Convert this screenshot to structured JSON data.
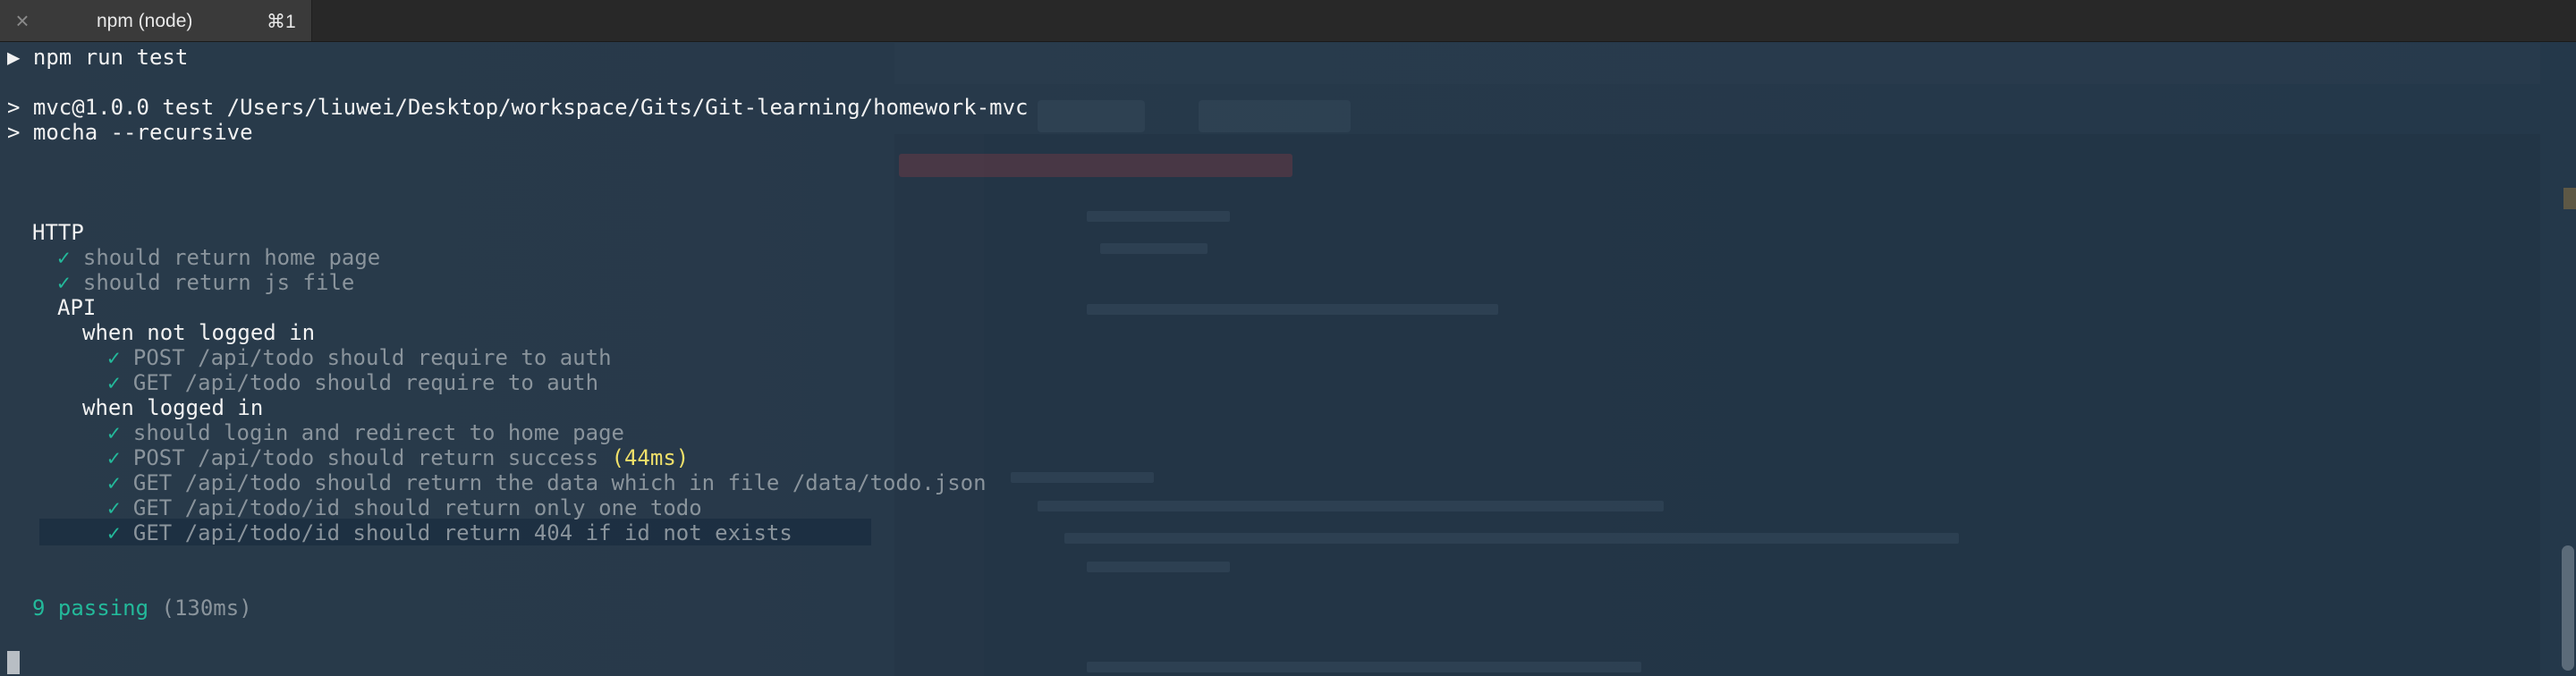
{
  "tab": {
    "title": "npm (node)",
    "shortcut": "⌘1",
    "close_icon": "close-icon"
  },
  "terminal": {
    "prompt_line": "▶ npm run test",
    "script_line": "> mvc@1.0.0 test /Users/liuwei/Desktop/workspace/Gits/Git-learning/homework-mvc",
    "command_line": "> mocha --recursive",
    "suite_http": "HTTP",
    "check_mark": "✓",
    "tests_http": [
      "should return home page",
      "should return js file"
    ],
    "suite_api": "API",
    "suite_not_logged": "when not logged in",
    "tests_not_logged": [
      "POST /api/todo should require to auth",
      "GET /api/todo should require to auth"
    ],
    "suite_logged": "when logged in",
    "tests_logged": [
      "should login and redirect to home page",
      "POST /api/todo should return success",
      "GET /api/todo should return the data which in file /data/todo.json",
      "GET /api/todo/id should return only one todo",
      "GET /api/todo/id should return 404 if id not exists"
    ],
    "slow_duration": "(44ms)",
    "passing_label": "9 passing",
    "passing_duration": "(130ms)"
  },
  "colors": {
    "background": "#263646",
    "check": "#23b99a",
    "slow": "#f0e06a",
    "dim_text": "#8a949c"
  }
}
